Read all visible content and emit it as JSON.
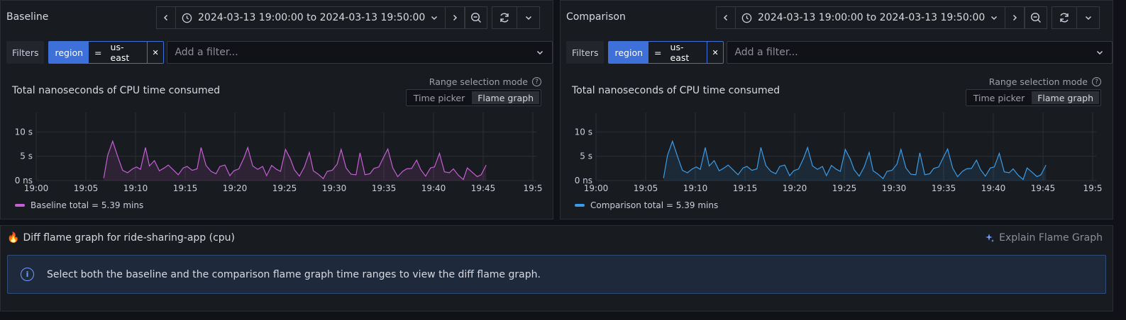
{
  "baseline": {
    "title": "Baseline",
    "time_range": "2024-03-13 19:00:00 to 2024-03-13 19:50:00",
    "filters_label": "Filters",
    "filter": {
      "key": "region",
      "op": "=",
      "value": "us-east"
    },
    "add_filter_placeholder": "Add a filter...",
    "range_mode_label": "Range selection mode",
    "mode_options": [
      "Time picker",
      "Flame graph"
    ],
    "mode_selected": "Flame graph",
    "legend": "Baseline total = 5.39 mins",
    "color": "#c55fd5",
    "fill": "rgba(197,95,213,0.12)"
  },
  "comparison": {
    "title": "Comparison",
    "time_range": "2024-03-13 19:00:00 to 2024-03-13 19:50:00",
    "filters_label": "Filters",
    "filter": {
      "key": "region",
      "op": "=",
      "value": "us-east"
    },
    "add_filter_placeholder": "Add a filter...",
    "range_mode_label": "Range selection mode",
    "mode_options": [
      "Time picker",
      "Flame graph"
    ],
    "mode_selected": "Flame graph",
    "legend": "Comparison total = 5.39 mins",
    "color": "#3a9ce8",
    "fill": "rgba(58,156,232,0.12)"
  },
  "chart_data": [
    {
      "type": "area",
      "title": "Total nanoseconds of CPU time consumed",
      "series": [
        {
          "name": "Baseline total = 5.39 mins",
          "x": [
            6.8,
            7.2,
            7.7,
            8.2,
            8.7,
            9.2,
            9.7,
            10.1,
            10.5,
            11.0,
            11.4,
            11.9,
            12.4,
            12.9,
            13.3,
            13.8,
            14.3,
            14.8,
            15.2,
            15.7,
            16.2,
            16.6,
            17.1,
            17.6,
            18.1,
            18.5,
            19.0,
            19.5,
            19.9,
            20.4,
            20.9,
            21.3,
            21.8,
            22.3,
            22.8,
            23.2,
            23.7,
            24.2,
            24.6,
            25.1,
            25.6,
            26.0,
            26.5,
            27.0,
            27.5,
            27.9,
            28.4,
            28.9,
            29.3,
            29.8,
            30.3,
            30.7,
            31.2,
            31.7,
            32.2,
            32.6,
            33.1,
            33.6,
            34.0,
            34.5,
            35.0,
            35.4,
            35.9,
            36.4,
            36.9,
            37.3,
            37.8,
            38.3,
            38.7,
            39.2,
            39.7,
            40.1,
            40.6,
            41.1,
            41.6,
            42.0,
            42.5,
            43.0,
            43.4,
            43.9,
            44.4,
            44.8,
            45.3
          ],
          "y": [
            0.5,
            5.2,
            8.1,
            5.0,
            2.1,
            1.6,
            2.4,
            2.8,
            2.3,
            6.8,
            3.0,
            4.1,
            2.0,
            2.6,
            3.2,
            2.2,
            1.2,
            2.6,
            2.9,
            2.1,
            2.4,
            6.8,
            3.1,
            1.9,
            1.4,
            2.9,
            3.2,
            1.0,
            2.0,
            2.4,
            4.6,
            6.8,
            3.0,
            2.3,
            2.9,
            1.0,
            3.1,
            2.3,
            1.9,
            6.4,
            4.4,
            2.2,
            0.9,
            2.8,
            5.8,
            2.0,
            1.3,
            0.4,
            1.9,
            2.1,
            3.4,
            6.4,
            2.6,
            1.3,
            1.2,
            5.7,
            1.2,
            1.4,
            2.5,
            2.8,
            4.9,
            6.5,
            2.6,
            0.8,
            1.9,
            2.4,
            2.5,
            4.2,
            2.3,
            0.9,
            2.6,
            2.8,
            5.6,
            1.8,
            1.6,
            2.4,
            1.1,
            0.2,
            2.6,
            1.7,
            0.8,
            1.2,
            3.2
          ]
        }
      ],
      "xlabel": "",
      "ylabel": "",
      "x_ticks": [
        "19:00",
        "19:05",
        "19:10",
        "19:15",
        "19:20",
        "19:25",
        "19:30",
        "19:35",
        "19:40",
        "19:45",
        "19:5"
      ],
      "y_ticks": [
        "0 ns",
        "5 s",
        "10 s"
      ],
      "xlim": [
        0,
        50
      ],
      "ylim": [
        0,
        14
      ]
    },
    {
      "type": "area",
      "title": "Total nanoseconds of CPU time consumed",
      "series": [
        {
          "name": "Comparison total = 5.39 mins",
          "x": [
            6.8,
            7.2,
            7.7,
            8.2,
            8.7,
            9.2,
            9.7,
            10.1,
            10.5,
            11.0,
            11.4,
            11.9,
            12.4,
            12.9,
            13.3,
            13.8,
            14.3,
            14.8,
            15.2,
            15.7,
            16.2,
            16.6,
            17.1,
            17.6,
            18.1,
            18.5,
            19.0,
            19.5,
            19.9,
            20.4,
            20.9,
            21.3,
            21.8,
            22.3,
            22.8,
            23.2,
            23.7,
            24.2,
            24.6,
            25.1,
            25.6,
            26.0,
            26.5,
            27.0,
            27.5,
            27.9,
            28.4,
            28.9,
            29.3,
            29.8,
            30.3,
            30.7,
            31.2,
            31.7,
            32.2,
            32.6,
            33.1,
            33.6,
            34.0,
            34.5,
            35.0,
            35.4,
            35.9,
            36.4,
            36.9,
            37.3,
            37.8,
            38.3,
            38.7,
            39.2,
            39.7,
            40.1,
            40.6,
            41.1,
            41.6,
            42.0,
            42.5,
            43.0,
            43.4,
            43.9,
            44.4,
            44.8,
            45.3
          ],
          "y": [
            0.5,
            5.2,
            8.1,
            5.0,
            2.1,
            1.6,
            2.4,
            2.8,
            2.3,
            6.8,
            3.0,
            4.1,
            2.0,
            2.6,
            3.2,
            2.2,
            1.2,
            2.6,
            2.9,
            2.1,
            2.4,
            6.8,
            3.1,
            1.9,
            1.4,
            2.9,
            3.2,
            1.0,
            2.0,
            2.4,
            4.6,
            6.8,
            3.0,
            2.3,
            2.9,
            1.0,
            3.1,
            2.3,
            1.9,
            6.4,
            4.4,
            2.2,
            0.9,
            2.8,
            5.8,
            2.0,
            1.3,
            0.4,
            1.9,
            2.1,
            3.4,
            6.4,
            2.6,
            1.3,
            1.2,
            5.7,
            1.2,
            1.4,
            2.5,
            2.8,
            4.9,
            6.5,
            2.6,
            0.8,
            1.9,
            2.4,
            2.5,
            4.2,
            2.3,
            0.9,
            2.6,
            2.8,
            5.6,
            1.8,
            1.6,
            2.4,
            1.1,
            0.2,
            2.6,
            1.7,
            0.8,
            1.2,
            3.2
          ]
        }
      ],
      "xlabel": "",
      "ylabel": "",
      "x_ticks": [
        "19:00",
        "19:05",
        "19:10",
        "19:15",
        "19:20",
        "19:25",
        "19:30",
        "19:35",
        "19:40",
        "19:45",
        "19:5"
      ],
      "y_ticks": [
        "0 ns",
        "5 s",
        "10 s"
      ],
      "xlim": [
        0,
        50
      ],
      "ylim": [
        0,
        14
      ]
    }
  ],
  "diff": {
    "icon": "🔥",
    "title": "Diff flame graph for ride-sharing-app (cpu)",
    "explain_label": "Explain Flame Graph",
    "info_message": "Select both the baseline and the comparison flame graph time ranges to view the diff flame graph."
  }
}
